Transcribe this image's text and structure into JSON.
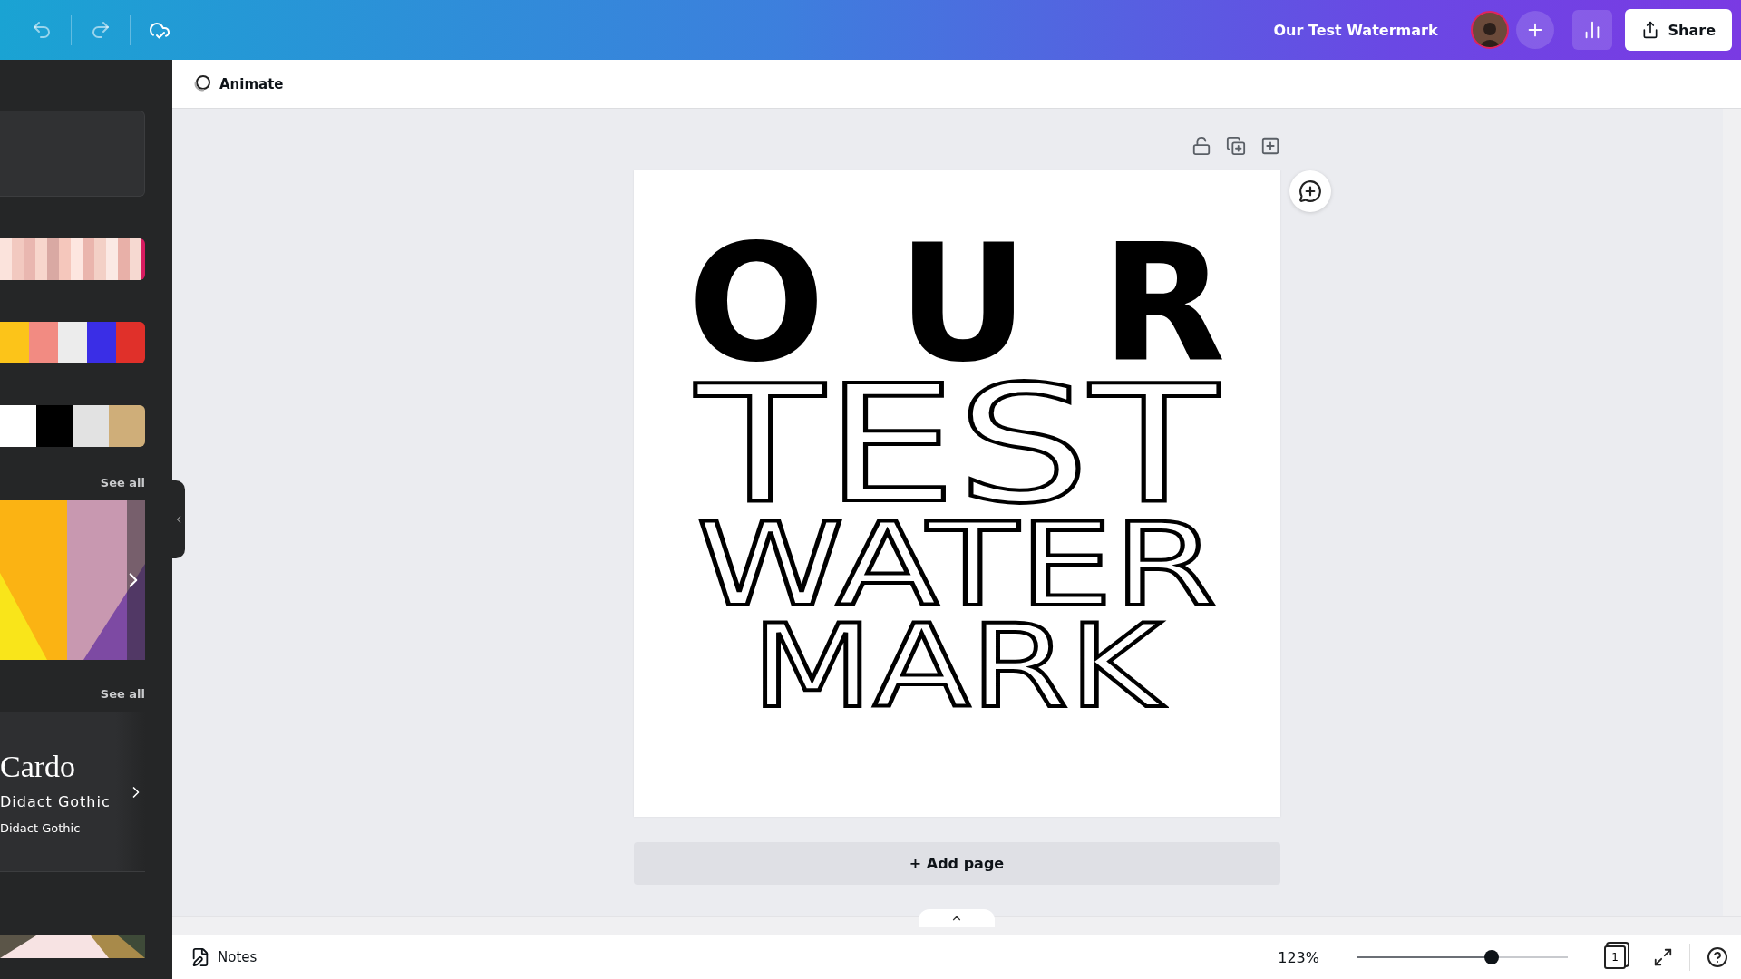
{
  "topbar": {
    "title": "Our Test Watermark",
    "share": "Share"
  },
  "toolbar": {
    "animate": "Animate"
  },
  "sidebar": {
    "palettes": [
      {
        "kind": "stripes",
        "swatches": [
          {
            "color": "#fbe3dc"
          },
          {
            "color": "#f2c9c0"
          },
          {
            "color": "#e9b7b0"
          },
          {
            "color": "#f7d6cc"
          },
          {
            "color": "#d9a9a3"
          },
          {
            "color": "#f5c7bc"
          },
          {
            "color": "#fde6e0"
          },
          {
            "color": "#eab5ad"
          },
          {
            "color": "#f3d0c6"
          },
          {
            "color": "#fbe9e4"
          },
          {
            "color": "#e8b0a8"
          },
          {
            "color": "#f6d9d1"
          },
          {
            "color": "#d81b60"
          }
        ]
      },
      {
        "kind": "swatches",
        "swatches": [
          {
            "color": "#fcc419"
          },
          {
            "color": "#f28b82"
          },
          {
            "color": "#ececec"
          },
          {
            "color": "#3a2ee6"
          },
          {
            "color": "#e0302a"
          }
        ]
      },
      {
        "kind": "swatches",
        "swatches": [
          {
            "color": "#ffffff"
          },
          {
            "color": "#000000"
          },
          {
            "color": "#e2e2e2"
          },
          {
            "color": "#cfae79"
          }
        ]
      }
    ],
    "see_all": [
      "See all",
      "See all"
    ],
    "fonts": [
      "Cardo",
      "Didact Gothic",
      "Didact Gothic"
    ]
  },
  "design": {
    "lines": [
      {
        "text": "OUR",
        "kind": "solid"
      },
      {
        "text": "TEST",
        "kind": "outline"
      },
      {
        "text": "WATER",
        "kind": "outline"
      },
      {
        "text": "MARK",
        "kind": "outline"
      }
    ]
  },
  "add_page": "+ Add page",
  "footer": {
    "notes": "Notes",
    "zoom": "123%",
    "zoom_slider": {
      "level": 0.64
    },
    "page_count": "1"
  }
}
